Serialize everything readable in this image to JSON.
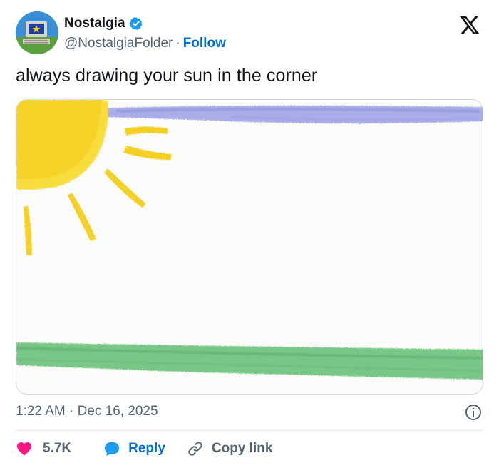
{
  "author": {
    "name": "Nostalgia",
    "handle": "@NostalgiaFolder",
    "separator": "·",
    "follow_label": "Follow"
  },
  "tweet": {
    "text": "always drawing your sun in the corner",
    "timestamp": "1:22 AM · Dec 16, 2025"
  },
  "actions": {
    "likes_count": "5.7K",
    "reply_label": "Reply",
    "copy_link_label": "Copy link"
  },
  "icons": {
    "brand": "x-logo-icon",
    "verified": "verified-badge-icon",
    "info": "info-icon",
    "like": "heart-icon",
    "reply": "speech-bubble-icon",
    "copy": "link-icon"
  },
  "colors": {
    "link_blue": "#006fd6",
    "heart_pink": "#f91880",
    "reply_blue": "#1d9bf0",
    "muted": "#536471",
    "sun_yellow": "#f7d733",
    "sky_blue": "#8c93e0",
    "grass_green": "#5fbf6a"
  }
}
